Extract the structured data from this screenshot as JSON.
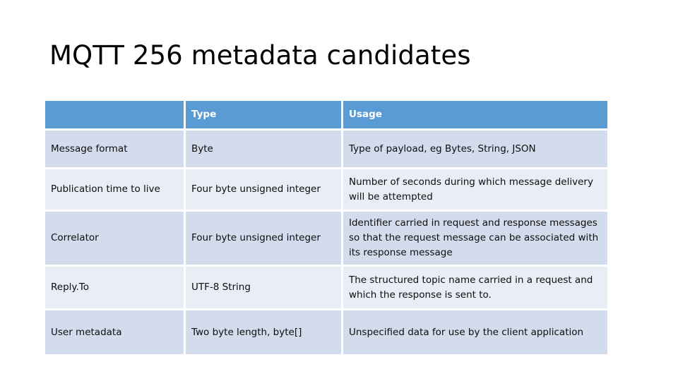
{
  "slide": {
    "title": "MQTT 256 metadata candidates",
    "background_color": "#FFFFFF",
    "title_color": "#000000"
  },
  "table": {
    "header_background": "#5B9BD5",
    "header_text_color": "#FFFFFF",
    "band_dark": "#D3DCEC",
    "band_light": "#E8EDF6",
    "body_text_color": "#0D0D0D",
    "columns": [
      {
        "key": "name",
        "label": ""
      },
      {
        "key": "type",
        "label": "Type"
      },
      {
        "key": "usage",
        "label": "Usage"
      }
    ],
    "rows": [
      {
        "name": "Message format",
        "type": "Byte",
        "usage": "Type of payload, eg Bytes, String, JSON"
      },
      {
        "name": "Publication time to live",
        "type": "Four byte unsigned integer",
        "usage": "Number of seconds during which message delivery will be attempted"
      },
      {
        "name": "Correlator",
        "type": "Four byte unsigned integer",
        "usage": "Identifier carried in request and response messages so that the request message can be associated with its response message"
      },
      {
        "name": "Reply.To",
        "type": "UTF-8 String",
        "usage": "The structured topic name carried in a request and which the response is sent to."
      },
      {
        "name": "User metadata",
        "type": "Two byte length, byte[]",
        "usage": "Unspecified data for use by the client application"
      }
    ]
  }
}
